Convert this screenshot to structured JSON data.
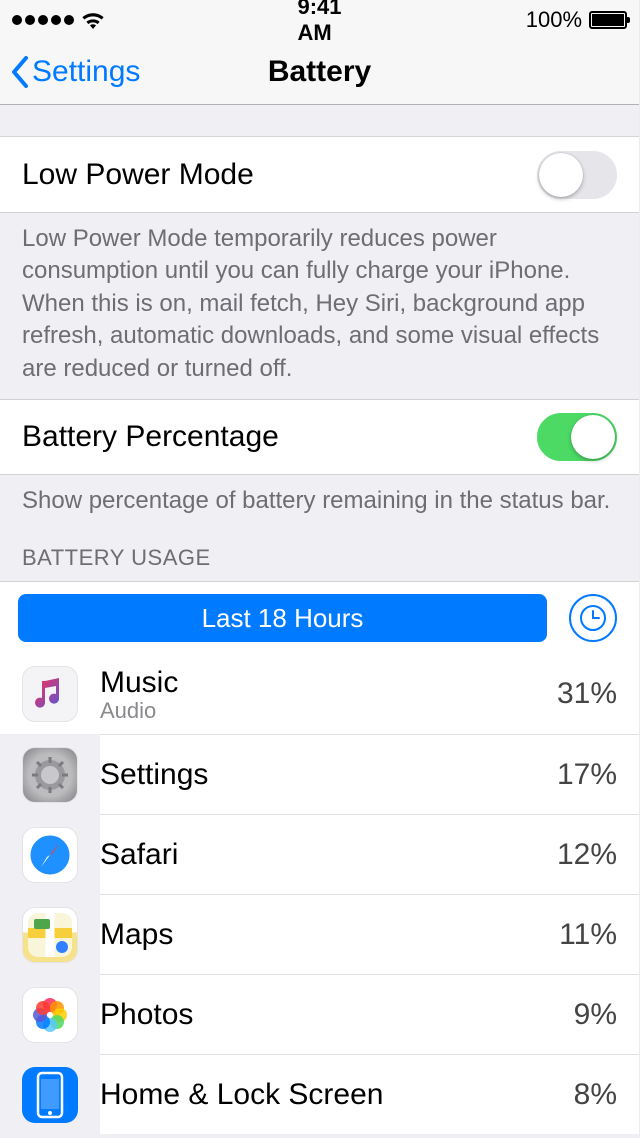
{
  "status": {
    "time": "9:41 AM",
    "battery_pct": "100%"
  },
  "nav": {
    "back": "Settings",
    "title": "Battery"
  },
  "lowPower": {
    "label": "Low Power Mode",
    "on": false,
    "footer": "Low Power Mode temporarily reduces power consumption until you can fully charge your iPhone. When this is on, mail fetch, Hey Siri, background app refresh, automatic downloads, and some visual effects are reduced or turned off."
  },
  "batteryPct": {
    "label": "Battery Percentage",
    "on": true,
    "footer": "Show percentage of battery remaining in the status bar."
  },
  "usage": {
    "header": "BATTERY USAGE",
    "segment": "Last 18 Hours",
    "apps": [
      {
        "name": "Music",
        "sub": "Audio",
        "pct": "31%",
        "icon": "music"
      },
      {
        "name": "Settings",
        "sub": "",
        "pct": "17%",
        "icon": "settings"
      },
      {
        "name": "Safari",
        "sub": "",
        "pct": "12%",
        "icon": "safari"
      },
      {
        "name": "Maps",
        "sub": "",
        "pct": "11%",
        "icon": "maps"
      },
      {
        "name": "Photos",
        "sub": "",
        "pct": "9%",
        "icon": "photos"
      },
      {
        "name": "Home & Lock Screen",
        "sub": "",
        "pct": "8%",
        "icon": "home"
      }
    ]
  }
}
